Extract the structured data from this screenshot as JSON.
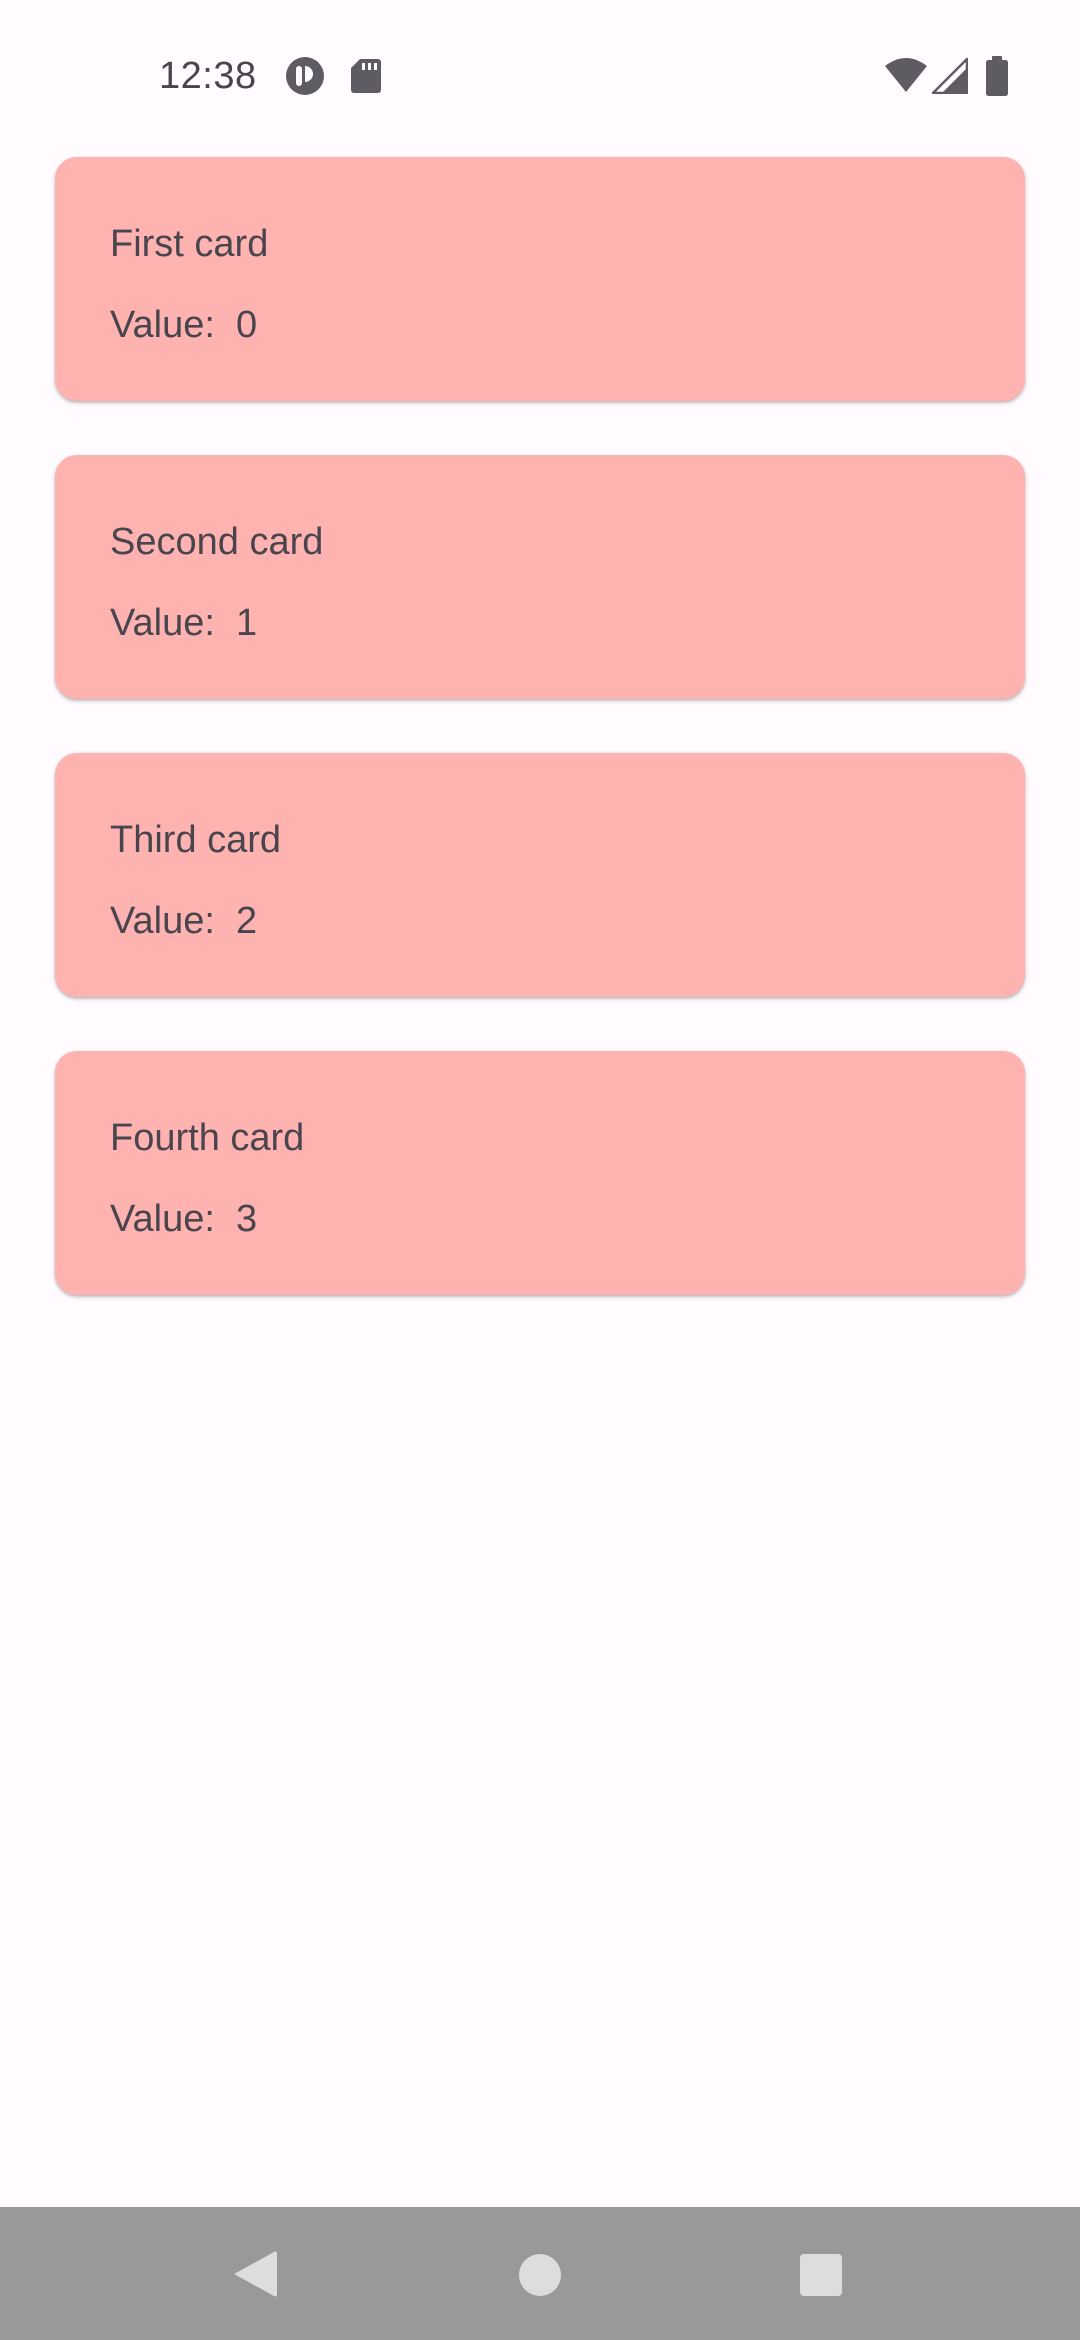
{
  "status_bar": {
    "time": "12:38",
    "icons": [
      "app-notification-icon",
      "sd-card-icon",
      "wifi-icon",
      "cell-signal-icon",
      "battery-icon"
    ]
  },
  "cards": [
    {
      "title": "First card",
      "value_text": "Value:  0"
    },
    {
      "title": "Second card",
      "value_text": "Value:  1"
    },
    {
      "title": "Third card",
      "value_text": "Value:  2"
    },
    {
      "title": "Fourth card",
      "value_text": "Value:  3"
    }
  ],
  "navigation_bar": {
    "buttons": [
      "back",
      "home",
      "recents"
    ]
  },
  "colors": {
    "background": "#FFFBFE",
    "card": "#FFB3B0",
    "text": "#49454F",
    "nav_bar": "#999999",
    "nav_icon": "#DDDDDD"
  }
}
